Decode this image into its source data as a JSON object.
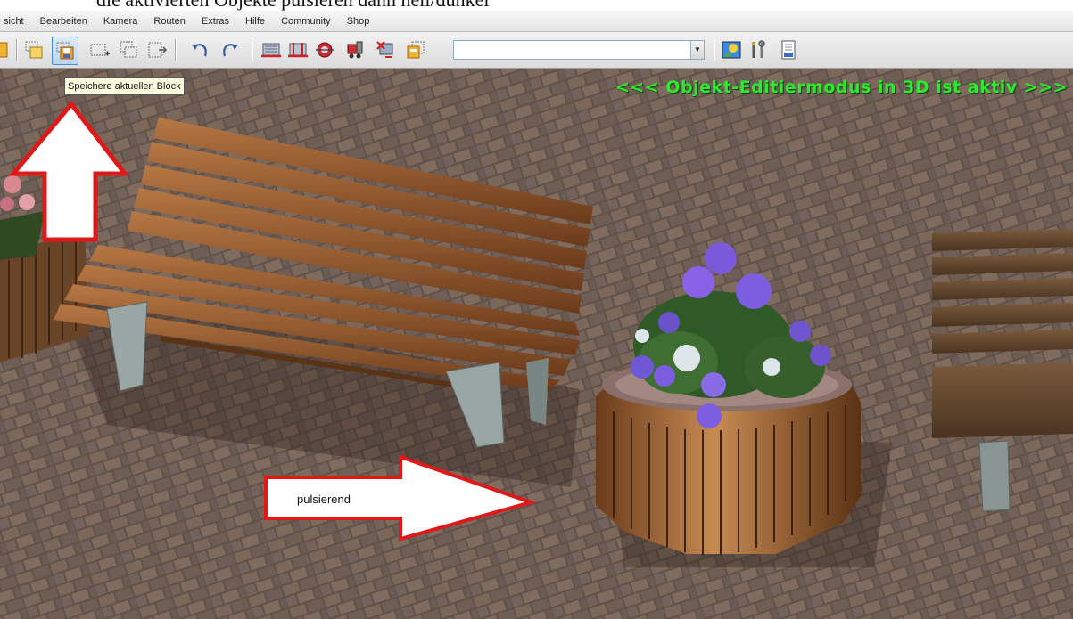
{
  "caption": {
    "text": "die aktivierten Objekte pulsieren dann hell/dunkel"
  },
  "menu": [
    "sicht",
    "Bearbeiten",
    "Kamera",
    "Routen",
    "Extras",
    "Hilfe",
    "Community",
    "Shop"
  ],
  "toolbar": {
    "tooltip": "Speichere aktuellen Block",
    "combo_value": ""
  },
  "viewport": {
    "mode_text": "<<<  Objekt-Editiermodus in 3D ist aktiv  >>>",
    "arrow_label": "pulsierend"
  },
  "colors": {
    "annotation_red": "#e01818",
    "mode_green": "#2eea2e"
  }
}
